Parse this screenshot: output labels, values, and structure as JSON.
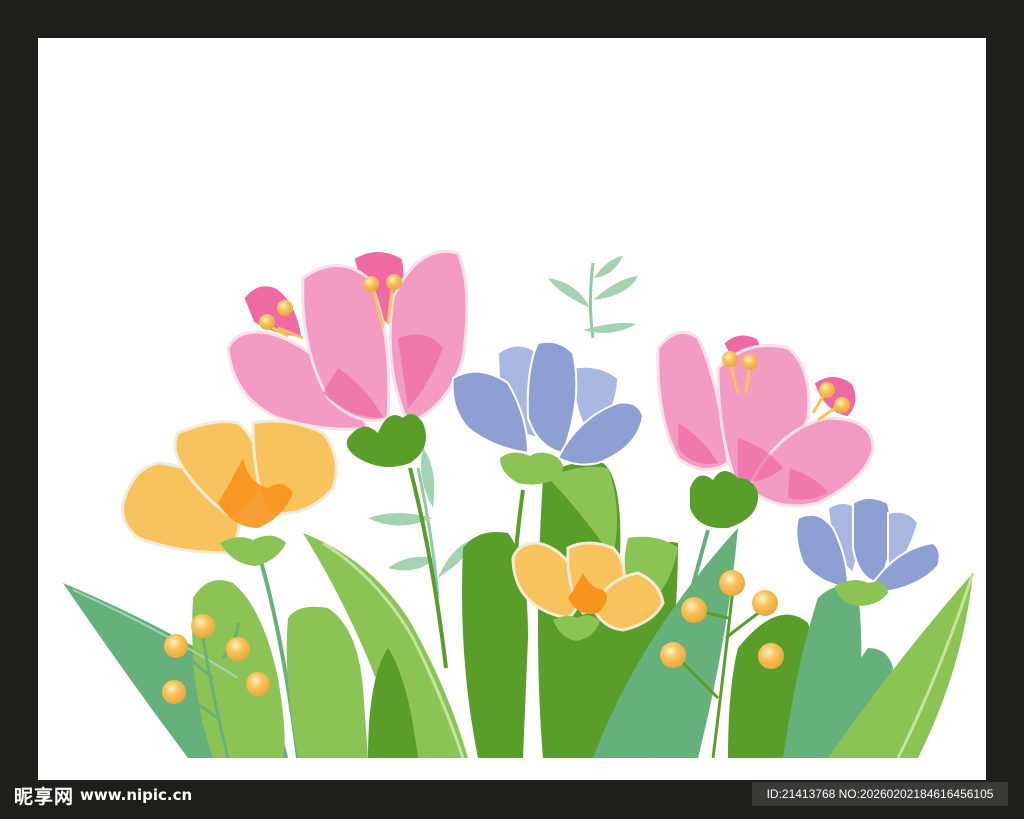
{
  "watermark": {
    "brand": "昵享网",
    "url": "www.nipic.cn",
    "id_text": "ID:21413768 NO:20260202184616456105"
  },
  "colors": {
    "frame": "#1e1f1a",
    "background": "#ffffff",
    "pink_flower": "#f49bc3",
    "pink_center": "#ef6aa5",
    "blue_flower": "#8e9fd4",
    "yellow_flower": "#f8c35c",
    "orange_center": "#f7941d",
    "leaf_dark": "#5a9e2a",
    "leaf_light": "#8cc355",
    "leaf_teal": "#66b07c",
    "berry": "#f8c35c"
  },
  "illustration": {
    "subject": "flowers-and-leaves",
    "flowers": [
      "pink-tulip",
      "pink-tulip",
      "blue-flower",
      "blue-flower",
      "yellow-flower",
      "yellow-flower"
    ],
    "berry_count": 11
  }
}
